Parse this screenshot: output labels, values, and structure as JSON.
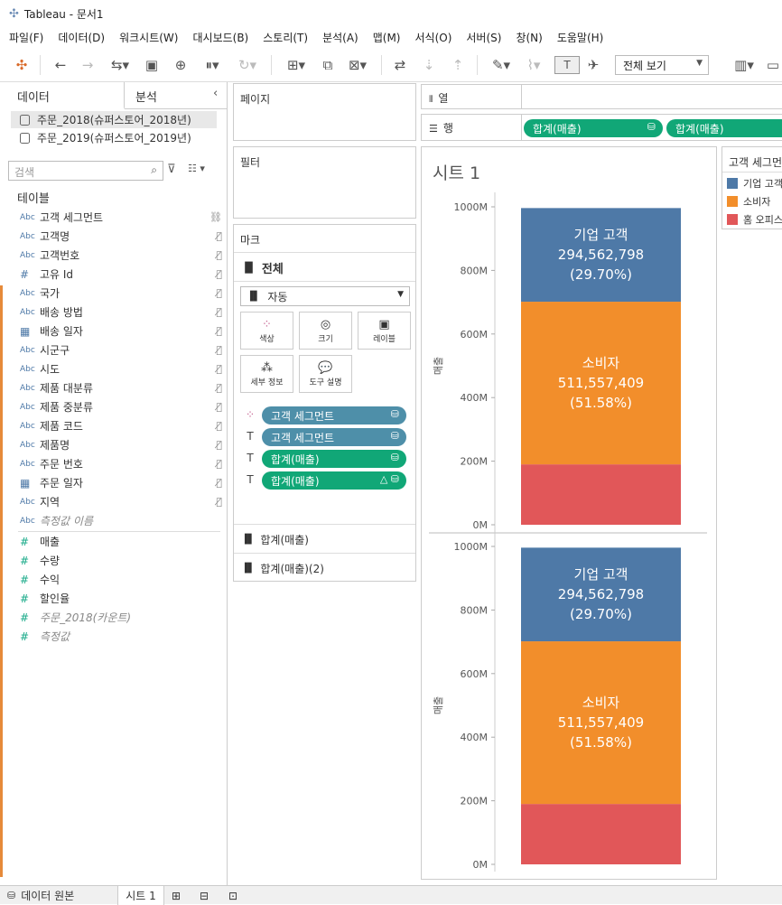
{
  "window": {
    "title": "Tableau - 문서1"
  },
  "menu": [
    "파일(F)",
    "데이터(D)",
    "워크시트(W)",
    "대시보드(B)",
    "스토리(T)",
    "분석(A)",
    "맵(M)",
    "서식(O)",
    "서버(S)",
    "창(N)",
    "도움말(H)"
  ],
  "toolbar": {
    "fit_label": "전체 보기"
  },
  "left_panel": {
    "tab_data": "데이터",
    "tab_analysis": "분석",
    "datasources": [
      "주문_2018(슈퍼스토어_2018년)",
      "주문_2019(슈퍼스토어_2019년)"
    ],
    "search_placeholder": "검색",
    "tables_header": "테이블",
    "dimensions": [
      {
        "type": "Abc",
        "name": "고객 세그먼트"
      },
      {
        "type": "Abc",
        "name": "고객명"
      },
      {
        "type": "Abc",
        "name": "고객번호"
      },
      {
        "type": "#",
        "name": "고유 Id"
      },
      {
        "type": "Abc",
        "name": "국가"
      },
      {
        "type": "Abc",
        "name": "배송 방법"
      },
      {
        "type": "date",
        "name": "배송 일자"
      },
      {
        "type": "Abc",
        "name": "시군구"
      },
      {
        "type": "Abc",
        "name": "시도"
      },
      {
        "type": "Abc",
        "name": "제품 대분류"
      },
      {
        "type": "Abc",
        "name": "제품 중분류"
      },
      {
        "type": "Abc",
        "name": "제품 코드"
      },
      {
        "type": "Abc",
        "name": "제품명"
      },
      {
        "type": "Abc",
        "name": "주문 번호"
      },
      {
        "type": "date",
        "name": "주문 일자"
      },
      {
        "type": "Abc",
        "name": "지역"
      },
      {
        "type": "Abc",
        "name": "측정값 이름"
      }
    ],
    "measures": [
      {
        "type": "#",
        "name": "매출"
      },
      {
        "type": "#",
        "name": "수량"
      },
      {
        "type": "#",
        "name": "수익"
      },
      {
        "type": "#",
        "name": "할인율"
      },
      {
        "type": "#",
        "name": "주문_2018(카운트)"
      },
      {
        "type": "#",
        "name": "측정값"
      }
    ]
  },
  "cards": {
    "pages": "페이지",
    "filters": "필터",
    "marks": "마크",
    "marks_all": "전체",
    "mark_type": "자동",
    "mark_buttons": [
      "색상",
      "크기",
      "레이블",
      "세부 정보",
      "도구 설명"
    ],
    "mark_pills": [
      "고객 세그먼트",
      "고객 세그먼트",
      "합계(매출)",
      "합계(매출)"
    ],
    "measure_sections": [
      "합계(매출)",
      "합계(매출)(2)"
    ]
  },
  "shelves": {
    "columns_label": "열",
    "rows_label": "행",
    "row_pills": [
      "합계(매출)",
      "합계(매출)"
    ]
  },
  "sheet": {
    "title": "시트 1",
    "axis_label": "매출"
  },
  "chart_data": [
    {
      "type": "bar",
      "stacked": true,
      "categories": [
        ""
      ],
      "ylim": [
        0,
        1000000000
      ],
      "yticks": [
        "0M",
        "200M",
        "400M",
        "600M",
        "800M",
        "1000M"
      ],
      "series": [
        {
          "name": "홈 오피스",
          "values": [
            190000000
          ]
        },
        {
          "name": "소비자",
          "values": [
            511557409
          ],
          "label": "소비자\n511,557,409\n(51.58%)"
        },
        {
          "name": "기업 고객",
          "values": [
            294562798
          ],
          "label": "기업 고객\n294,562,798\n(29.70%)"
        }
      ]
    },
    {
      "type": "bar",
      "stacked": true,
      "categories": [
        ""
      ],
      "ylim": [
        0,
        1000000000
      ],
      "yticks": [
        "0M",
        "200M",
        "400M",
        "600M",
        "800M",
        "1000M"
      ],
      "series": [
        {
          "name": "홈 오피스",
          "values": [
            190000000
          ]
        },
        {
          "name": "소비자",
          "values": [
            511557409
          ],
          "label": "소비자\n511,557,409\n(51.58%)"
        },
        {
          "name": "기업 고객",
          "values": [
            294562798
          ],
          "label": "기업 고객\n294,562,798\n(29.70%)"
        }
      ]
    }
  ],
  "legend": {
    "title": "고객 세그먼트",
    "items": [
      {
        "name": "기업 고객",
        "color": "#4e79a7"
      },
      {
        "name": "소비자",
        "color": "#f28e2b"
      },
      {
        "name": "홈 오피스",
        "color": "#e15759"
      }
    ]
  },
  "bottom": {
    "datasource_tab": "데이터 원본",
    "sheet_tab": "시트 1"
  }
}
